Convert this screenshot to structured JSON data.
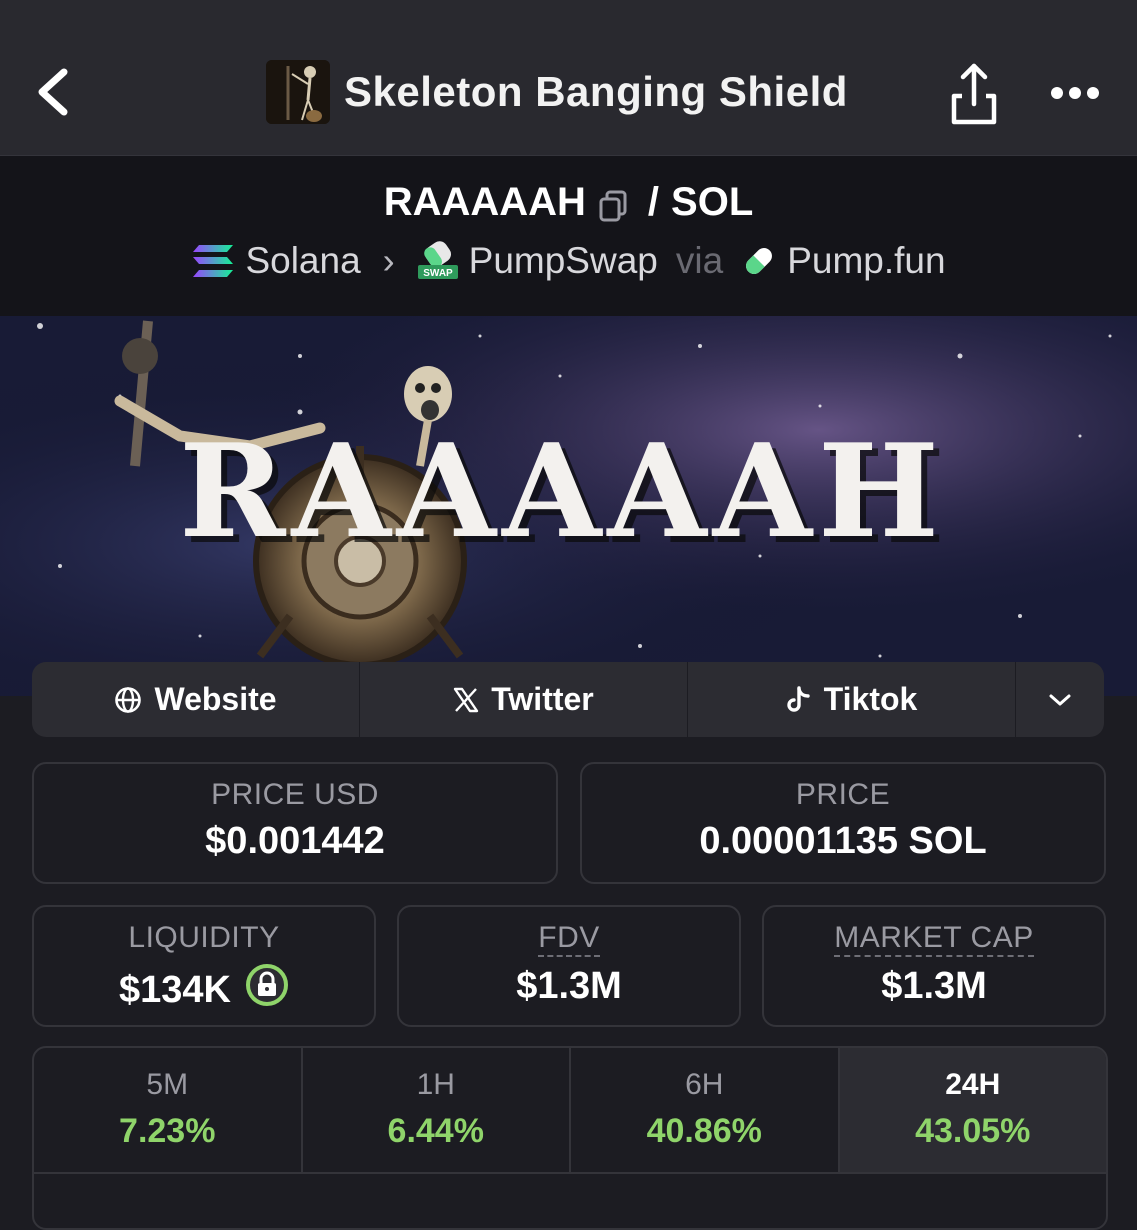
{
  "header": {
    "title": "Skeleton Banging Shield",
    "back_icon": "chevron-left-icon",
    "share_icon": "share-icon",
    "more_icon": "more-horizontal-icon"
  },
  "pair": {
    "base": "RAAAAAH",
    "separator": "/",
    "quote": "SOL",
    "chain": "Solana",
    "dex": "PumpSwap",
    "dex_badge": "SWAP",
    "via": "via",
    "launchpad": "Pump.fun"
  },
  "banner": {
    "text": "RAAAAAH"
  },
  "links": {
    "website": "Website",
    "twitter": "Twitter",
    "tiktok": "Tiktok"
  },
  "stats": {
    "price_usd_label": "PRICE USD",
    "price_usd": "$0.001442",
    "price_label": "PRICE",
    "price": "0.00001135 SOL",
    "liquidity_label": "LIQUIDITY",
    "liquidity": "$134K",
    "fdv_label": "FDV",
    "fdv": "$1.3M",
    "mcap_label": "MARKET CAP",
    "mcap": "$1.3M"
  },
  "timeframes": [
    {
      "label": "5M",
      "change": "7.23%"
    },
    {
      "label": "1H",
      "change": "6.44%"
    },
    {
      "label": "6H",
      "change": "40.86%"
    },
    {
      "label": "24H",
      "change": "43.05%"
    }
  ],
  "colors": {
    "positive": "#8fd46a",
    "background": "#1c1c22",
    "topbar": "#29292f",
    "lock_ring": "#8fd46a"
  }
}
